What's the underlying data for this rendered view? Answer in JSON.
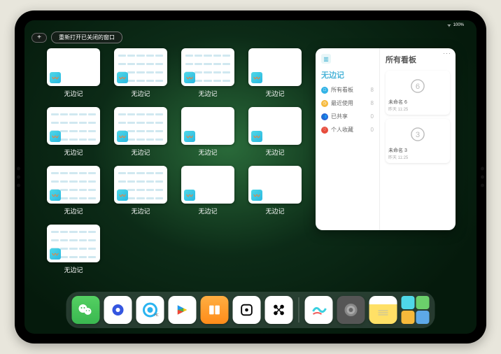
{
  "statusbar": {
    "wifi": "ᯤ",
    "battery": "100%",
    "signal": "•••"
  },
  "topbar": {
    "plus": "+",
    "reopen": "重新打开已关闭的窗口"
  },
  "app_name": "无边记",
  "tiles": [
    {
      "type": "blank"
    },
    {
      "type": "cal"
    },
    {
      "type": "cal"
    },
    {
      "type": "blank"
    },
    {
      "type": "cal"
    },
    {
      "type": "cal"
    },
    {
      "type": "blank"
    },
    {
      "type": "blank"
    },
    {
      "type": "cal"
    },
    {
      "type": "cal"
    },
    {
      "type": "blank"
    },
    {
      "type": "blank"
    },
    {
      "type": "cal"
    }
  ],
  "panel": {
    "ellipsis": "···",
    "left_title": "无边记",
    "right_title": "所有看板",
    "items": [
      {
        "icon": "d-blue",
        "sym": "□",
        "label": "所有看板",
        "count": "8"
      },
      {
        "icon": "d-yel",
        "sym": "◷",
        "label": "最近使用",
        "count": "8"
      },
      {
        "icon": "d-blu2",
        "sym": "👥",
        "label": "已共享",
        "count": "0"
      },
      {
        "icon": "d-red",
        "sym": "♡",
        "label": "个人收藏",
        "count": "0"
      }
    ],
    "boards": [
      {
        "name": "未命名 6",
        "sub": "昨天 11:25",
        "digit": "6"
      },
      {
        "name": "未命名 3",
        "sub": "昨天 11:25",
        "digit": "3"
      }
    ]
  },
  "dock": {
    "apps": [
      "wechat",
      "quark",
      "qqbrowser",
      "play",
      "books",
      "dice",
      "connect"
    ],
    "recent": [
      "freeform",
      "settings",
      "notes"
    ]
  }
}
